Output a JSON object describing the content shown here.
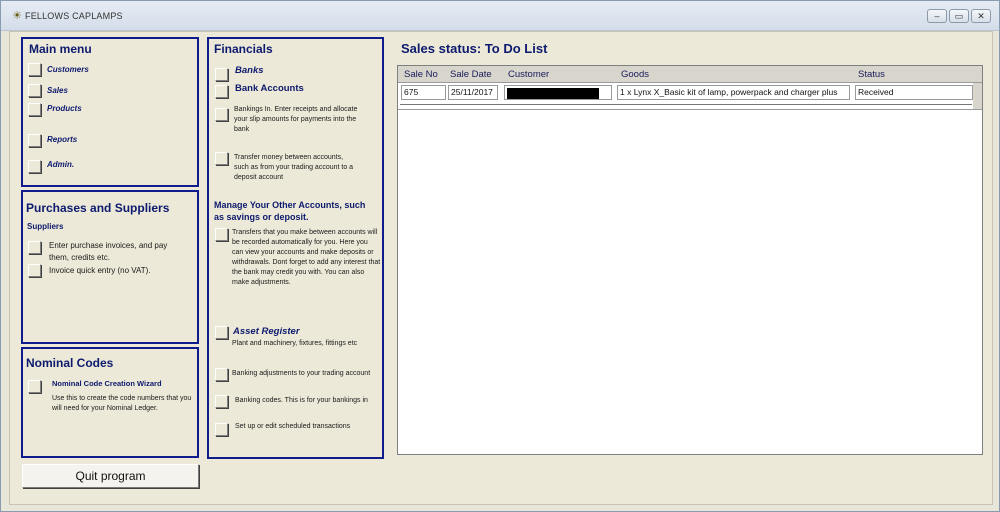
{
  "window": {
    "title": "FELLOWS CAPLAMPS",
    "minimize": "–",
    "restore": "▭",
    "close": "✕"
  },
  "main_menu": {
    "title": "Main menu",
    "items": [
      {
        "label": "Customers"
      },
      {
        "label": "Sales"
      },
      {
        "label": "Products"
      },
      {
        "label": "Reports"
      },
      {
        "label": "Admin."
      }
    ]
  },
  "purchases": {
    "title": "Purchases and Suppliers",
    "subtitle": "Suppliers",
    "items": [
      {
        "label": "Enter purchase invoices, and pay them, credits etc."
      },
      {
        "label": "Invoice quick entry (no VAT)."
      }
    ]
  },
  "nominal": {
    "title": "Nominal Codes",
    "wizard_label": "Nominal Code Creation Wizard",
    "wizard_desc": "Use this to create the code numbers that you will need for your Nominal Ledger."
  },
  "quit": {
    "label": "Quit program"
  },
  "financials": {
    "title": "Financials",
    "banks": "Banks",
    "bank_accounts": "Bank Accounts",
    "bankings_in": "Bankings In. Enter receipts and allocate your slip amounts for payments into the bank",
    "transfer": "Transfer money between accounts, such as from your trading account to a deposit account",
    "manage_title": "Manage Your Other Accounts, such as savings or deposit.",
    "manage_desc": "Transfers that you make between accounts will be recorded automatically for you. Here you can view your accounts and make deposits or withdrawals. Dont forget to add any interest that the bank may credit you with. You can also make adjustments.",
    "asset_title": "Asset Register",
    "asset_desc": "Plant and machinery, fixtures, fittings etc",
    "banking_adjustments": "Banking adjustments to your trading account",
    "banking_codes": "Banking codes. This is for your bankings in",
    "scheduled": "Set up or edit scheduled transactions"
  },
  "sales_status": {
    "title": "Sales status: To Do List",
    "columns": [
      "Sale No",
      "Sale Date",
      "Customer",
      "Goods",
      "Status"
    ],
    "rows": [
      {
        "sale_no": "675",
        "sale_date": "25/11/2017",
        "customer": "",
        "goods": "1 x Lynx X_Basic kit of lamp, powerpack and charger plus",
        "status": "Received"
      }
    ]
  }
}
